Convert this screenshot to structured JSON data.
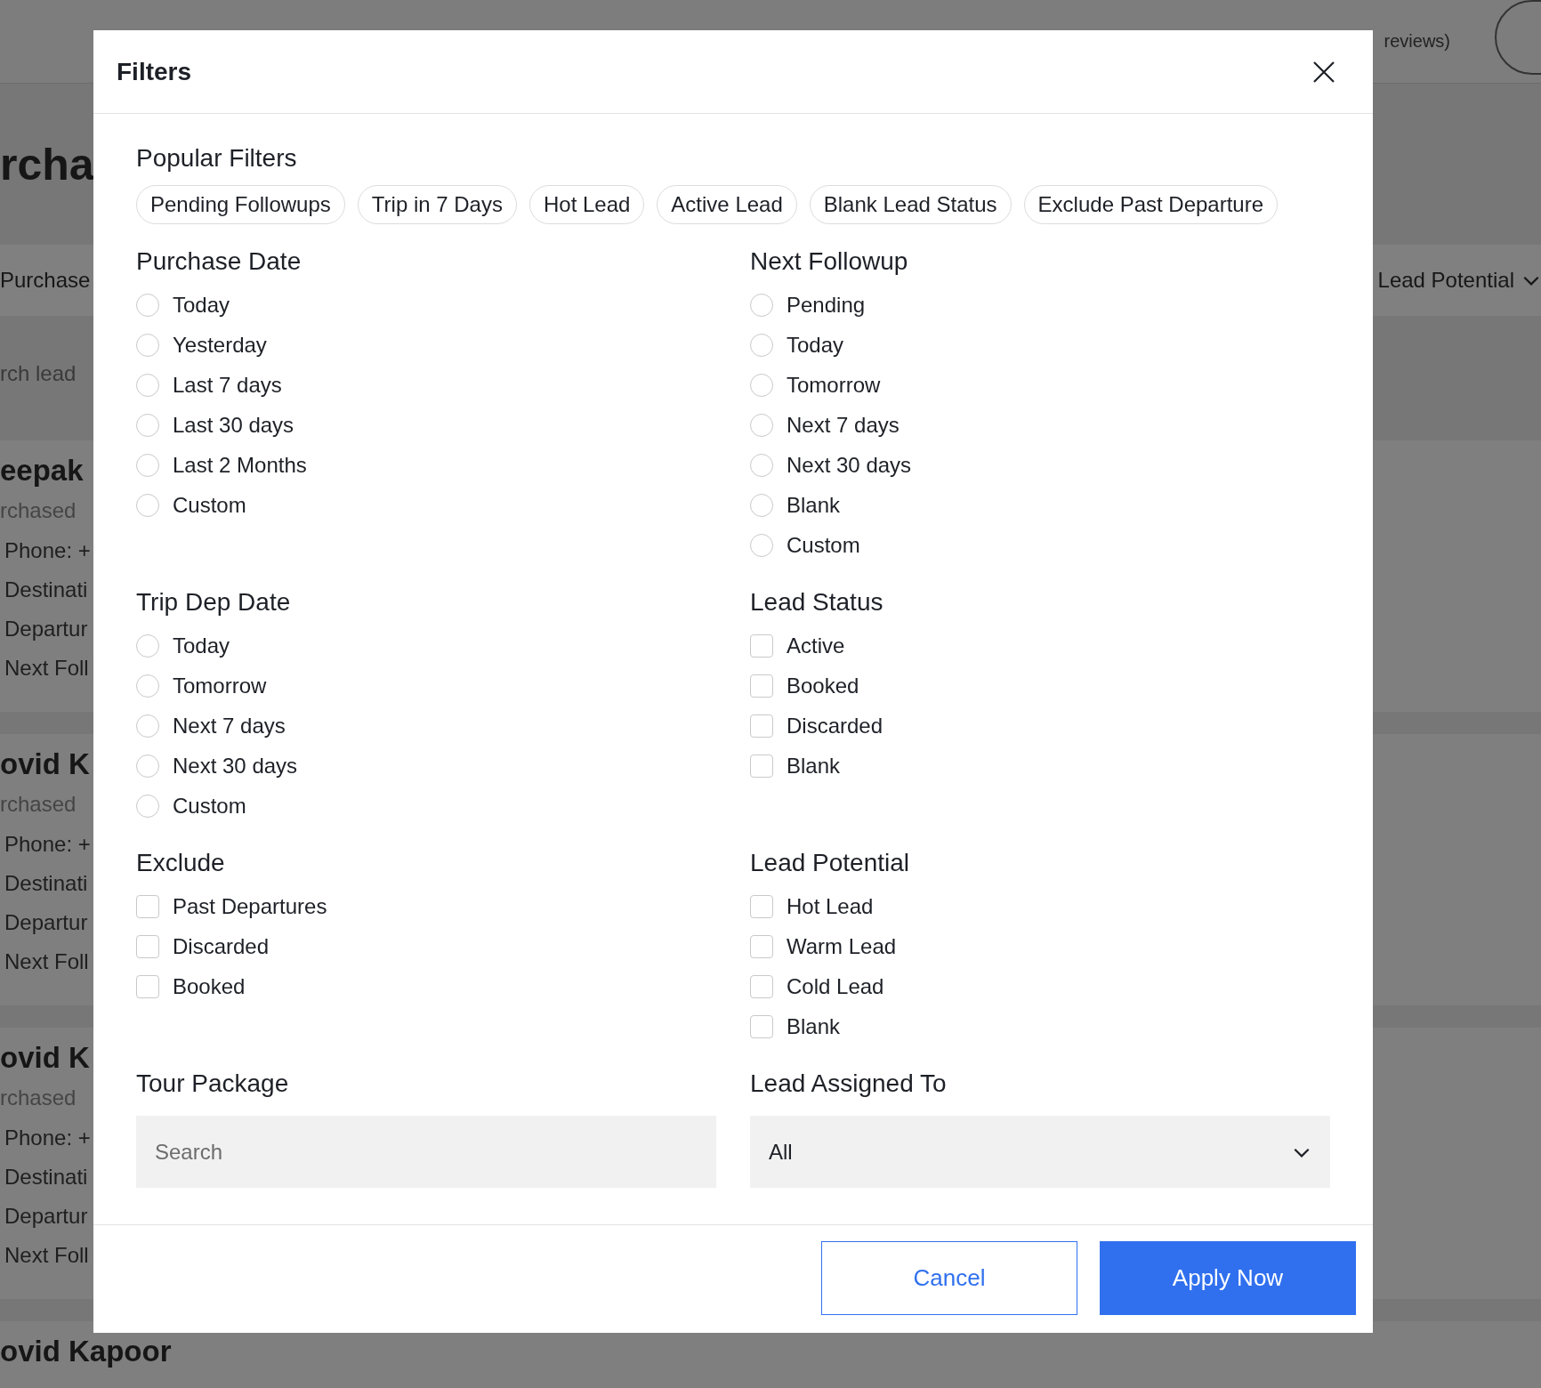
{
  "page": {
    "rating_text": "reviews)",
    "title": "rcha",
    "tab": "Purchase",
    "column_filter": "Lead Potential",
    "search_placeholder": "rch lead",
    "leads": [
      {
        "name": "eepak",
        "purchased": "rchased",
        "lines": [
          "Phone: +",
          "Destinati",
          "Departur",
          "Next Foll"
        ]
      },
      {
        "name": "ovid K",
        "purchased": "rchased",
        "lines": [
          "Phone: +",
          "Destinati",
          "Departur",
          "Next Foll"
        ]
      },
      {
        "name": "ovid K",
        "purchased": "rchased",
        "lines": [
          "Phone: +",
          "Destinati",
          "Departur",
          "Next Foll"
        ]
      },
      {
        "name": "ovid Kapoor"
      }
    ]
  },
  "dialog": {
    "title": "Filters",
    "popular_title": "Popular Filters",
    "popular_filters": [
      {
        "label": "Pending Followups",
        "selected": false
      },
      {
        "label": "Trip in 7 Days",
        "selected": false
      },
      {
        "label": "Hot Lead",
        "selected": false
      },
      {
        "label": "Active Lead",
        "selected": false
      },
      {
        "label": "Blank Lead Status",
        "selected": false
      },
      {
        "label": "Exclude Past Departure",
        "selected": false
      }
    ],
    "sections": [
      {
        "title": "Purchase Date",
        "kind": "radio",
        "options": [
          {
            "label": "Today",
            "selected": false
          },
          {
            "label": "Yesterday",
            "selected": false
          },
          {
            "label": "Last 7 days",
            "selected": false
          },
          {
            "label": "Last 30 days",
            "selected": false
          },
          {
            "label": "Last 2 Months",
            "selected": false
          },
          {
            "label": "Custom",
            "selected": false
          }
        ]
      },
      {
        "title": "Next Followup",
        "kind": "radio",
        "options": [
          {
            "label": "Pending",
            "selected": false
          },
          {
            "label": "Today",
            "selected": false
          },
          {
            "label": "Tomorrow",
            "selected": false
          },
          {
            "label": "Next 7 days",
            "selected": false
          },
          {
            "label": "Next 30 days",
            "selected": false
          },
          {
            "label": "Blank",
            "selected": false
          },
          {
            "label": "Custom",
            "selected": false
          }
        ]
      },
      {
        "title": "Trip Dep Date",
        "kind": "radio",
        "options": [
          {
            "label": "Today",
            "selected": false
          },
          {
            "label": "Tomorrow",
            "selected": false
          },
          {
            "label": "Next 7 days",
            "selected": false
          },
          {
            "label": "Next 30 days",
            "selected": false
          },
          {
            "label": "Custom",
            "selected": false
          }
        ]
      },
      {
        "title": "Lead Status",
        "kind": "checkbox",
        "options": [
          {
            "label": "Active",
            "checked": false
          },
          {
            "label": "Booked",
            "checked": false
          },
          {
            "label": "Discarded",
            "checked": false
          },
          {
            "label": "Blank",
            "checked": false
          }
        ]
      },
      {
        "title": "Exclude",
        "kind": "checkbox",
        "options": [
          {
            "label": "Past Departures",
            "checked": false
          },
          {
            "label": "Discarded",
            "checked": false
          },
          {
            "label": "Booked",
            "checked": false
          }
        ]
      },
      {
        "title": "Lead Potential",
        "kind": "checkbox",
        "options": [
          {
            "label": "Hot Lead",
            "checked": false
          },
          {
            "label": "Warm Lead",
            "checked": false
          },
          {
            "label": "Cold Lead",
            "checked": false
          },
          {
            "label": "Blank",
            "checked": false
          }
        ]
      },
      {
        "title": "Tour Package",
        "kind": "search",
        "placeholder": "Search"
      },
      {
        "title": "Lead Assigned To",
        "kind": "select",
        "value": "All"
      }
    ],
    "buttons": [
      {
        "label": "Cancel",
        "kind": "secondary"
      },
      {
        "label": "Apply Now",
        "kind": "primary"
      }
    ]
  }
}
